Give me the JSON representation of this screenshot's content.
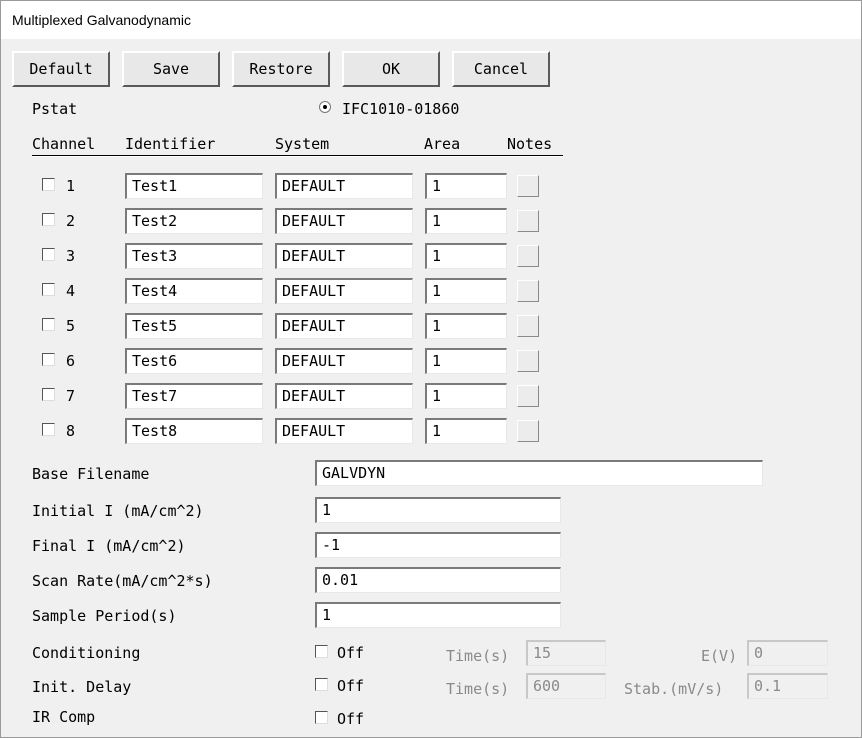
{
  "window": {
    "title": "Multiplexed Galvanodynamic"
  },
  "toolbar": {
    "default": "Default",
    "save": "Save",
    "restore": "Restore",
    "ok": "OK",
    "cancel": "Cancel"
  },
  "pstat": {
    "label": "Pstat",
    "option": "IFC1010-01860"
  },
  "table": {
    "headers": {
      "channel": "Channel",
      "identifier": "Identifier",
      "system": "System",
      "area": "Area",
      "notes": "Notes"
    },
    "rows": [
      {
        "channel": "1",
        "identifier": "Test1",
        "system": "DEFAULT",
        "area": "1",
        "checked": false
      },
      {
        "channel": "2",
        "identifier": "Test2",
        "system": "DEFAULT",
        "area": "1",
        "checked": false
      },
      {
        "channel": "3",
        "identifier": "Test3",
        "system": "DEFAULT",
        "area": "1",
        "checked": false
      },
      {
        "channel": "4",
        "identifier": "Test4",
        "system": "DEFAULT",
        "area": "1",
        "checked": false
      },
      {
        "channel": "5",
        "identifier": "Test5",
        "system": "DEFAULT",
        "area": "1",
        "checked": false
      },
      {
        "channel": "6",
        "identifier": "Test6",
        "system": "DEFAULT",
        "area": "1",
        "checked": false
      },
      {
        "channel": "7",
        "identifier": "Test7",
        "system": "DEFAULT",
        "area": "1",
        "checked": false
      },
      {
        "channel": "8",
        "identifier": "Test8",
        "system": "DEFAULT",
        "area": "1",
        "checked": false
      }
    ]
  },
  "params": {
    "base_filename": {
      "label": "Base Filename",
      "value": "GALVDYN"
    },
    "initial_i": {
      "label": "Initial I (mA/cm^2)",
      "value": "1"
    },
    "final_i": {
      "label": "Final I (mA/cm^2)",
      "value": "-1"
    },
    "scan_rate": {
      "label": "Scan Rate(mA/cm^2*s)",
      "value": "0.01"
    },
    "sample_period": {
      "label": "Sample Period(s)",
      "value": "1"
    }
  },
  "conditioning": {
    "label": "Conditioning",
    "toggle": "Off",
    "time_label": "Time(s)",
    "time_value": "15",
    "e_label": "E(V)",
    "e_value": "0"
  },
  "init_delay": {
    "label": "Init. Delay",
    "toggle": "Off",
    "time_label": "Time(s)",
    "time_value": "600",
    "stab_label": "Stab.(mV/s)",
    "stab_value": "0.1"
  },
  "ir_comp": {
    "label": "IR Comp",
    "toggle": "Off"
  }
}
